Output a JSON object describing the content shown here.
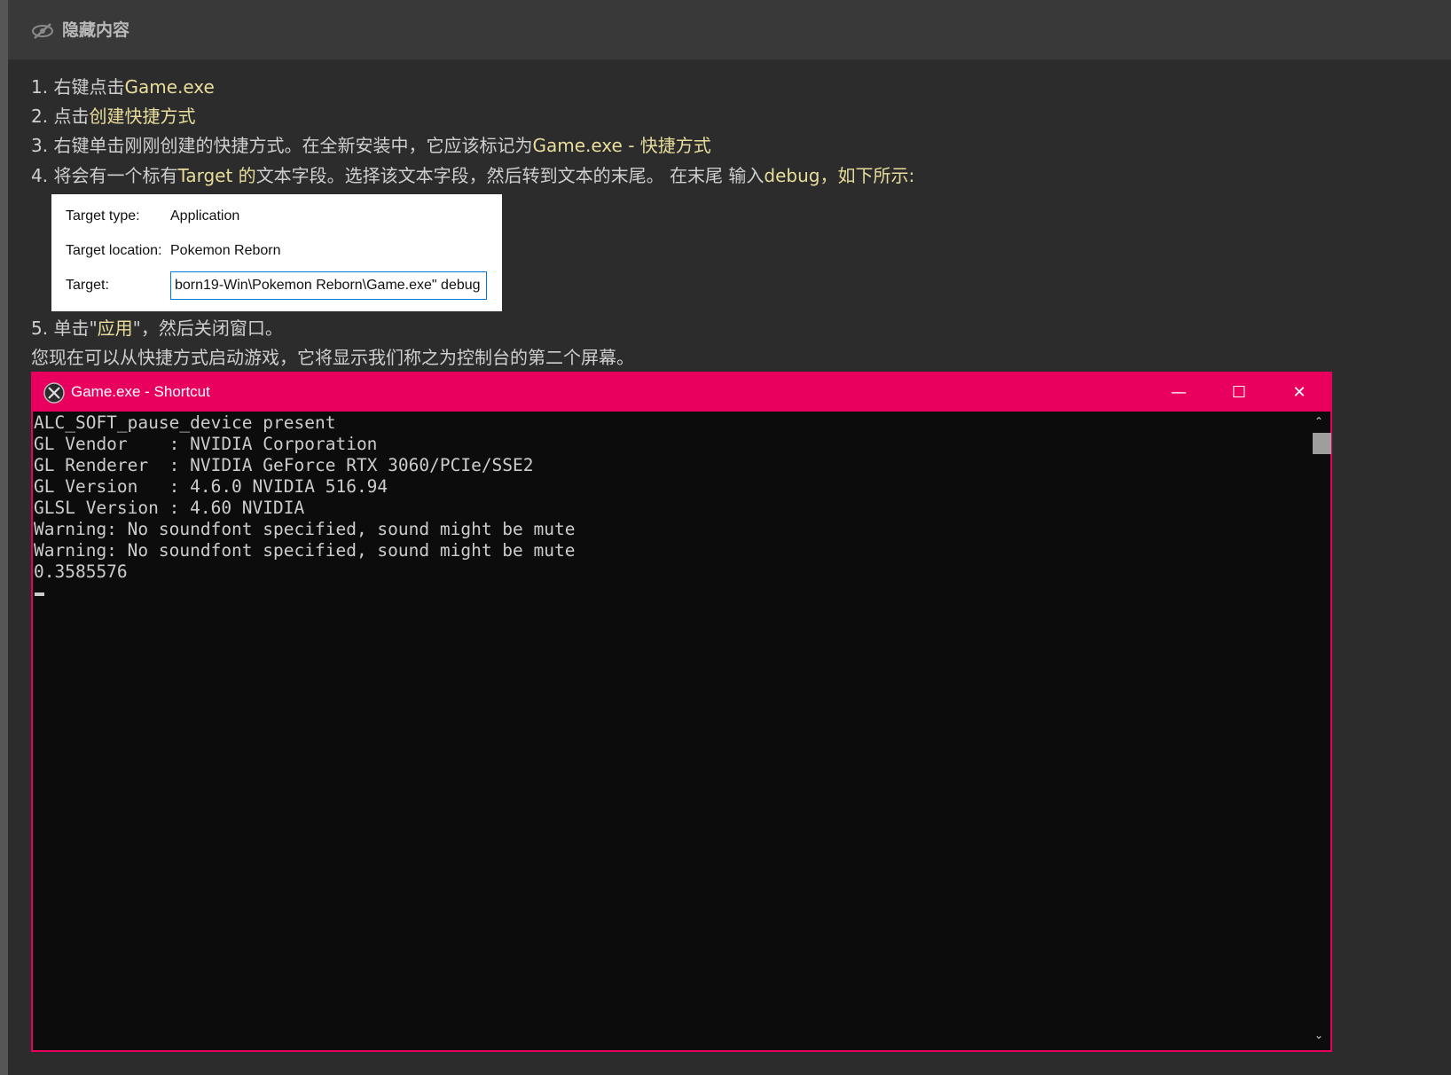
{
  "header": {
    "title": "隐藏内容",
    "icon": "eye-slash-icon"
  },
  "steps": [
    {
      "prefix": "1. 右键点击",
      "hl": "Game.exe"
    },
    {
      "prefix": "2. 点击",
      "hl": "创建快捷方式"
    },
    {
      "prefix": "3. 右键单击刚刚创建的快捷方式。在全新安装中，它应该标记为",
      "hl": "Game.exe - 快捷方式"
    },
    {
      "prefix": "4. 将会有一个标有",
      "hl1": "Target 的",
      "mid": "文本字段。选择该文本字段，然后转到文本的末尾。 在末尾 输入",
      "hl2": "debug",
      "suffix": "，如下所示:"
    },
    {
      "prefix": "5. 单击\"",
      "hl": "应用",
      "suffix": "\"，然后关闭窗口。"
    }
  ],
  "note": "您现在可以从快捷方式启动游戏，它将显示我们称之为控制台的第二个屏幕。",
  "properties": {
    "target_type_label": "Target type:",
    "target_type_value": "Application",
    "target_location_label": "Target location:",
    "target_location_value": "Pokemon Reborn",
    "target_label": "Target:",
    "target_value": "born19-Win\\Pokemon Reborn\\Game.exe\" debug"
  },
  "console": {
    "title": "Game.exe - Shortcut",
    "minimize": "—",
    "maximize": "☐",
    "close": "✕",
    "lines": [
      "ALC_SOFT_pause_device present",
      "GL Vendor    : NVIDIA Corporation",
      "GL Renderer  : NVIDIA GeForce RTX 3060/PCIe/SSE2",
      "GL Version   : 4.6.0 NVIDIA 516.94",
      "GLSL Version : 4.60 NVIDIA",
      "Warning: No soundfont specified, sound might be mute",
      "Warning: No soundfont specified, sound might be mute",
      "0.3585576"
    ]
  },
  "colors": {
    "accent": "#e9005f",
    "highlight": "#e8dd9c",
    "text": "#cfcfcf",
    "bg": "#2c2c2c"
  }
}
